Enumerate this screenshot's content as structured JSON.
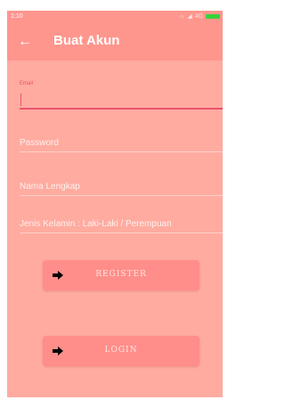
{
  "status_bar": {
    "time": "1:10",
    "network": "4G"
  },
  "app_bar": {
    "title": "Buat Akun",
    "back_icon": "arrow-left-icon"
  },
  "form": {
    "email": {
      "label": "Email",
      "value": ""
    },
    "password": {
      "placeholder": "Password"
    },
    "full_name": {
      "placeholder": "Nama Lengkap"
    },
    "gender": {
      "placeholder": "Jenis Kelamin : Laki-Laki / Perempuan"
    }
  },
  "buttons": {
    "register": {
      "label": "REGISTER",
      "icon": "arrow-right-icon"
    },
    "login": {
      "label": "LOGIN",
      "icon": "arrow-right-icon"
    }
  },
  "colors": {
    "background": "#ffaba0",
    "app_bar": "#ff968e",
    "accent": "#e8536e",
    "button": "#ff8e8a",
    "battery": "#39d23a"
  }
}
